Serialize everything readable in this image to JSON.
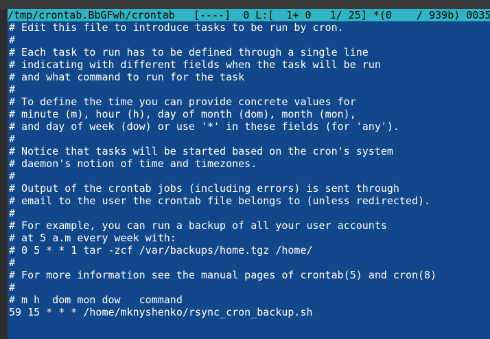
{
  "status_bar": {
    "file_path": "/tmp/crontab.BbGFwh/crontab",
    "flags": "[----]",
    "position": "0 L:[  1+ 0   1/ 25] *(0    / 939b) 0035"
  },
  "editor": {
    "lines": [
      "# Edit this file to introduce tasks to be run by cron.",
      "#",
      "# Each task to run has to be defined through a single line",
      "# indicating with different fields when the task will be run",
      "# and what command to run for the task",
      "#",
      "# To define the time you can provide concrete values for",
      "# minute (m), hour (h), day of month (dom), month (mon),",
      "# and day of week (dow) or use '*' in these fields (for 'any').",
      "#",
      "# Notice that tasks will be started based on the cron's system",
      "# daemon's notion of time and timezones.",
      "#",
      "# Output of the crontab jobs (including errors) is sent through",
      "# email to the user the crontab file belongs to (unless redirected).",
      "#",
      "# For example, you can run a backup of all your user accounts",
      "# at 5 a.m every week with:",
      "# 0 5 * * 1 tar -zcf /var/backups/home.tgz /home/",
      "#",
      "# For more information see the manual pages of crontab(5) and cron(8)",
      "#",
      "# m h  dom mon dow   command",
      "59 15 * * * /home/mknyshenko/rsync_cron_backup.sh"
    ]
  },
  "colors": {
    "status_bg": "#30b4c4",
    "editor_bg": "#12478a",
    "text": "#ffffff"
  }
}
